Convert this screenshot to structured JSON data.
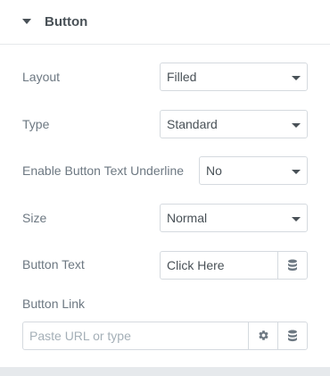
{
  "section": {
    "title": "Button",
    "collapse_icon": "caret-down-icon"
  },
  "layout": {
    "label": "Layout",
    "value": "Filled"
  },
  "type": {
    "label": "Type",
    "value": "Standard"
  },
  "underline": {
    "label": "Enable Button Text Underline",
    "value": "No"
  },
  "size": {
    "label": "Size",
    "value": "Normal"
  },
  "button_text": {
    "label": "Button Text",
    "value": "Click Here",
    "dynamic_icon": "database-icon"
  },
  "button_link": {
    "label": "Button Link",
    "placeholder": "Paste URL or type",
    "settings_icon": "gear-icon",
    "dynamic_icon": "database-icon"
  },
  "colors": {
    "label": "#6d7882",
    "value": "#495157",
    "border": "#d5dadf",
    "placeholder": "#a4afb7",
    "footer": "#e6e9ec"
  }
}
